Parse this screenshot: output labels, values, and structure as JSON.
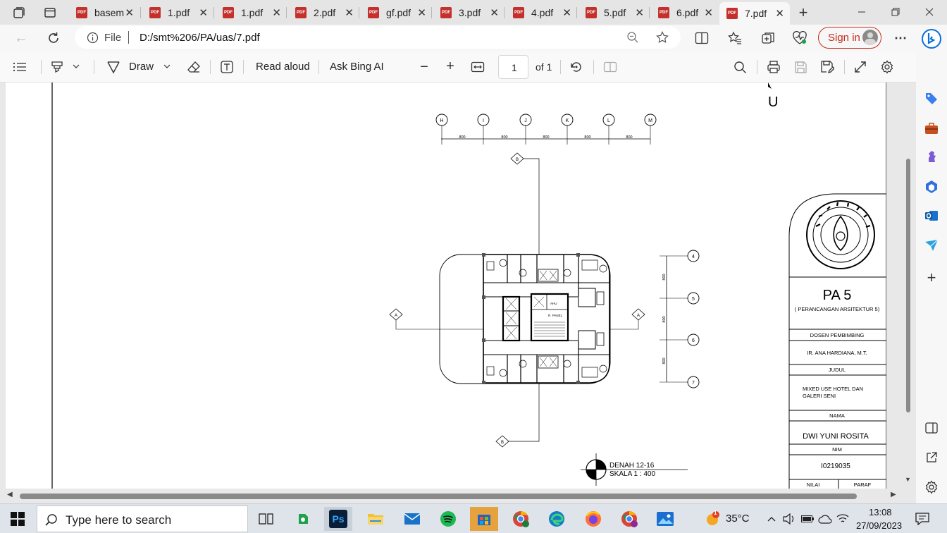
{
  "tabs": [
    {
      "label": "basem"
    },
    {
      "label": "1.pdf"
    },
    {
      "label": "1.pdf"
    },
    {
      "label": "2.pdf"
    },
    {
      "label": "gf.pdf"
    },
    {
      "label": "3.pdf"
    },
    {
      "label": "4.pdf"
    },
    {
      "label": "5.pdf"
    },
    {
      "label": "6.pdf"
    },
    {
      "label": "7.pdf"
    }
  ],
  "tab_icon_text": "PDF",
  "address": {
    "scheme_label": "File",
    "url": "D:/smt%206/PA/uas/7.pdf"
  },
  "signin_label": "Sign in",
  "pdf_toolbar": {
    "draw_label": "Draw",
    "read_aloud_label": "Read aloud",
    "ask_bing_label": "Ask Bing AI",
    "page_number": "1",
    "page_total": "of 1"
  },
  "drawing": {
    "north_label": "U",
    "grid_top": [
      "H",
      "I",
      "J",
      "K",
      "L",
      "M"
    ],
    "grid_right": [
      "4",
      "5",
      "6",
      "7"
    ],
    "dim_top": "800",
    "dim_right": "800",
    "section_a": "A",
    "section_b": "B",
    "room_ahu": "AHU",
    "room_panel": "R. PANEL",
    "caption_line1": "DENAH 12-16",
    "caption_line2": "SKALA 1 : 400"
  },
  "titleblock": {
    "project": "PA 5",
    "project_sub": "( PERANCANGAN ARSITEKTUR 5)",
    "lecturer_header": "DOSEN PEMBIMBING",
    "lecturer": "IR. ANA HARDIANA, M.T.",
    "title_header": "JUDUL",
    "title_line1": "MIXED USE HOTEL DAN",
    "title_line2": "GALERI SENI",
    "name_header": "NAMA",
    "name": "DWI YUNI ROSITA",
    "nim_header": "NIM",
    "nim": "I0219035",
    "grade_header": "NILAI",
    "sign_header": "PARAF"
  },
  "taskbar": {
    "search_placeholder": "Type here to search",
    "temperature": "35°C",
    "time": "13:08",
    "date": "27/09/2023",
    "ps_label": "Ps",
    "weather_badge": "1"
  },
  "colors": {
    "accent_red": "#c42b1c",
    "pdf_icon": "#c4302b",
    "edge_blue": "#0078d4"
  }
}
